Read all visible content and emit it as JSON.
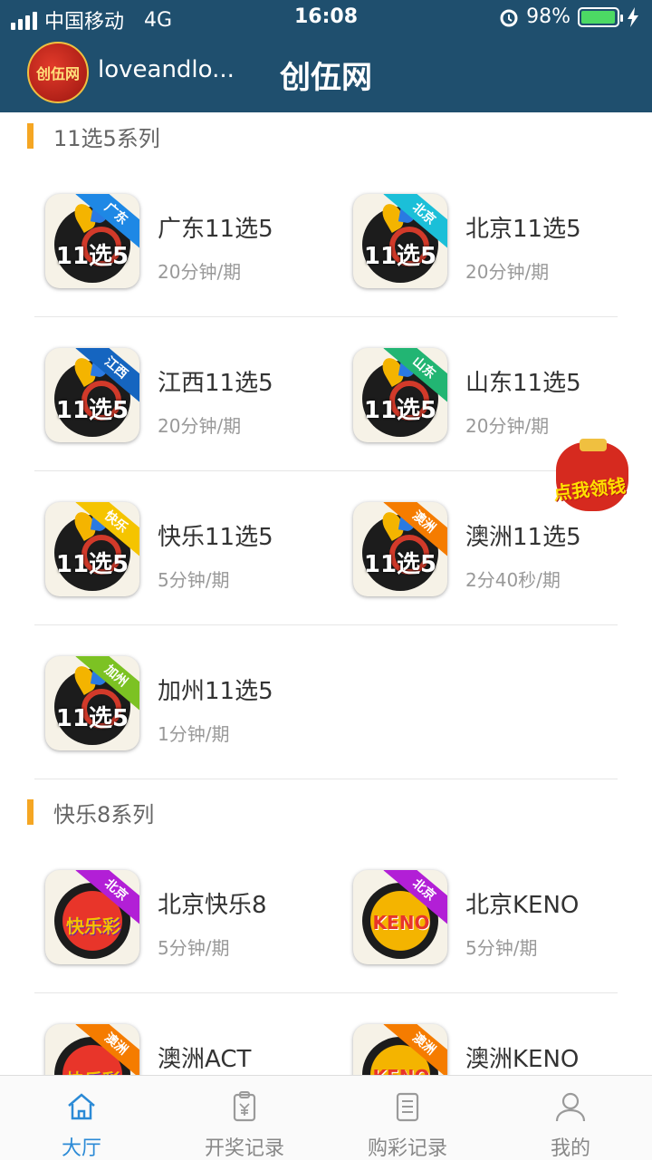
{
  "status_bar": {
    "carrier": "中国移动",
    "network": "4G",
    "time": "16:08",
    "battery_percent": "98%",
    "battery_level": 0.98
  },
  "header": {
    "logo_text": "创伍网",
    "username": "loveandlo...",
    "title": "创伍网"
  },
  "sections": [
    {
      "title": "11选5系列",
      "items": [
        {
          "region": "广东",
          "name": "广东11选5",
          "period": "20分钟/期",
          "ribbon_color": "#1e88e5",
          "type": "11x5"
        },
        {
          "region": "北京",
          "name": "北京11选5",
          "period": "20分钟/期",
          "ribbon_color": "#1bbfd8",
          "type": "11x5"
        },
        {
          "region": "江西",
          "name": "江西11选5",
          "period": "20分钟/期",
          "ribbon_color": "#1565c0",
          "type": "11x5"
        },
        {
          "region": "山东",
          "name": "山东11选5",
          "period": "20分钟/期",
          "ribbon_color": "#22b573",
          "type": "11x5"
        },
        {
          "region": "快乐",
          "name": "快乐11选5",
          "period": "5分钟/期",
          "ribbon_color": "#f5c400",
          "type": "11x5"
        },
        {
          "region": "澳洲",
          "name": "澳洲11选5",
          "period": "2分40秒/期",
          "ribbon_color": "#f57c00",
          "type": "11x5"
        },
        {
          "region": "加州",
          "name": "加州11选5",
          "period": "1分钟/期",
          "ribbon_color": "#7cc223",
          "type": "11x5"
        }
      ]
    },
    {
      "title": "快乐8系列",
      "items": [
        {
          "region": "北京",
          "name": "北京快乐8",
          "period": "5分钟/期",
          "ribbon_color": "#b21fd6",
          "type": "kl8"
        },
        {
          "region": "北京",
          "name": "北京KENO",
          "period": "5分钟/期",
          "ribbon_color": "#b21fd6",
          "type": "keno"
        },
        {
          "region": "澳洲",
          "name": "澳洲ACT",
          "period": "",
          "ribbon_color": "#f57c00",
          "type": "kl8"
        },
        {
          "region": "澳洲",
          "name": "澳洲KENO",
          "period": "",
          "ribbon_color": "#f57c00",
          "type": "keno"
        }
      ]
    }
  ],
  "icon_text": {
    "x11": "11选5",
    "kl8": "快乐彩",
    "keno": "KENO"
  },
  "float_ad": {
    "label": "点我领钱"
  },
  "tabbar": {
    "tabs": [
      {
        "label": "大厅",
        "icon": "home-icon",
        "active": true
      },
      {
        "label": "开奖记录",
        "icon": "clipboard-yen-icon",
        "active": false
      },
      {
        "label": "购彩记录",
        "icon": "document-list-icon",
        "active": false
      },
      {
        "label": "我的",
        "icon": "user-icon",
        "active": false
      }
    ],
    "active_color": "#2b8ad6"
  },
  "colors": {
    "header_bg": "#1f4f6e",
    "section_accent": "#f5a623"
  }
}
